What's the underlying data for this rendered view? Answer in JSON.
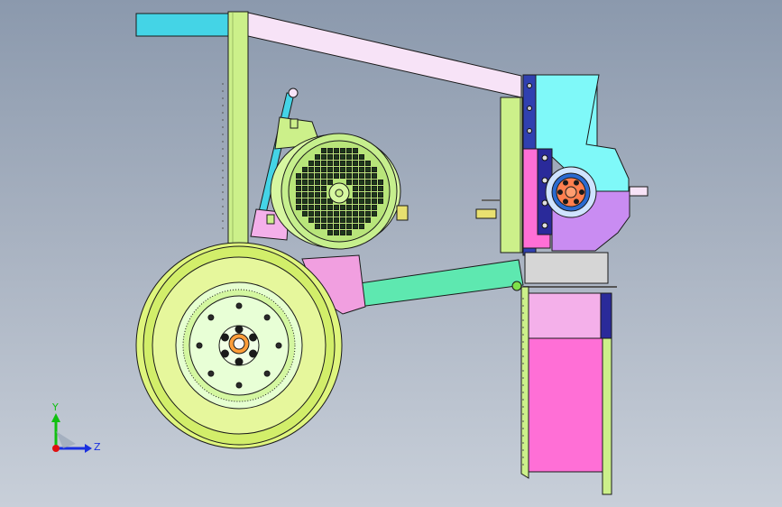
{
  "triad": {
    "y_label": "Y",
    "z_label": "Z",
    "colors": {
      "y_axis": "#10c010",
      "z_axis": "#1a30e0",
      "origin": "#e01010"
    }
  },
  "colors": {
    "frame_green": "#ccf08a",
    "frame_lavender": "#f7e3f7",
    "frame_cyan": "#44d4e6",
    "beam_mint": "#5ee8b0",
    "motor_housing": "#d7f7a1",
    "hopper_cyan": "#7ff9f9",
    "hopper_magenta": "#ff6fd6",
    "hopper_pink": "#f4b0ea",
    "hopper_purple": "#c98cf2",
    "hub_orange": "#ff7f4f",
    "tire_yellow": "#dff57d",
    "navy": "#2a2a9a",
    "panel_gray": "#d6d6d6",
    "outline": "#1a1a1a"
  }
}
